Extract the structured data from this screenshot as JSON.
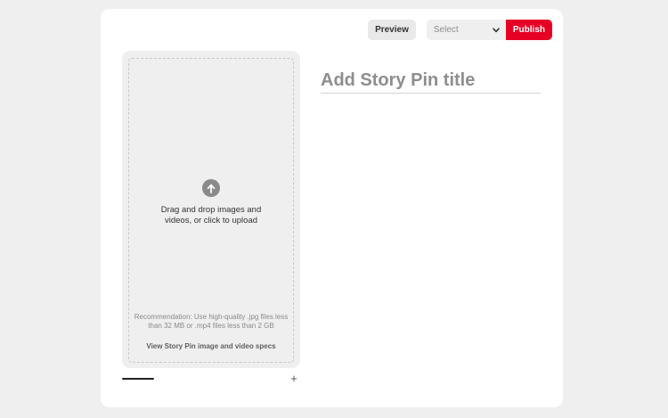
{
  "toolbar": {
    "preview_label": "Preview",
    "board_select": {
      "selected": "Select"
    },
    "publish_label": "Publish"
  },
  "upload": {
    "prompt": "Drag and drop images and videos, or click to upload",
    "recommendation": "Recommendation: Use high-quality .jpg files less than 32 MB or .mp4 files less than 2 GB",
    "specs_link": "View Story Pin image and video specs",
    "icon": "upload-arrow-icon"
  },
  "pages": {
    "add_label": "+"
  },
  "title": {
    "placeholder": "Add Story Pin title",
    "value": ""
  },
  "colors": {
    "publish": "#e60023",
    "panel": "#efefef",
    "background": "#efefef"
  }
}
